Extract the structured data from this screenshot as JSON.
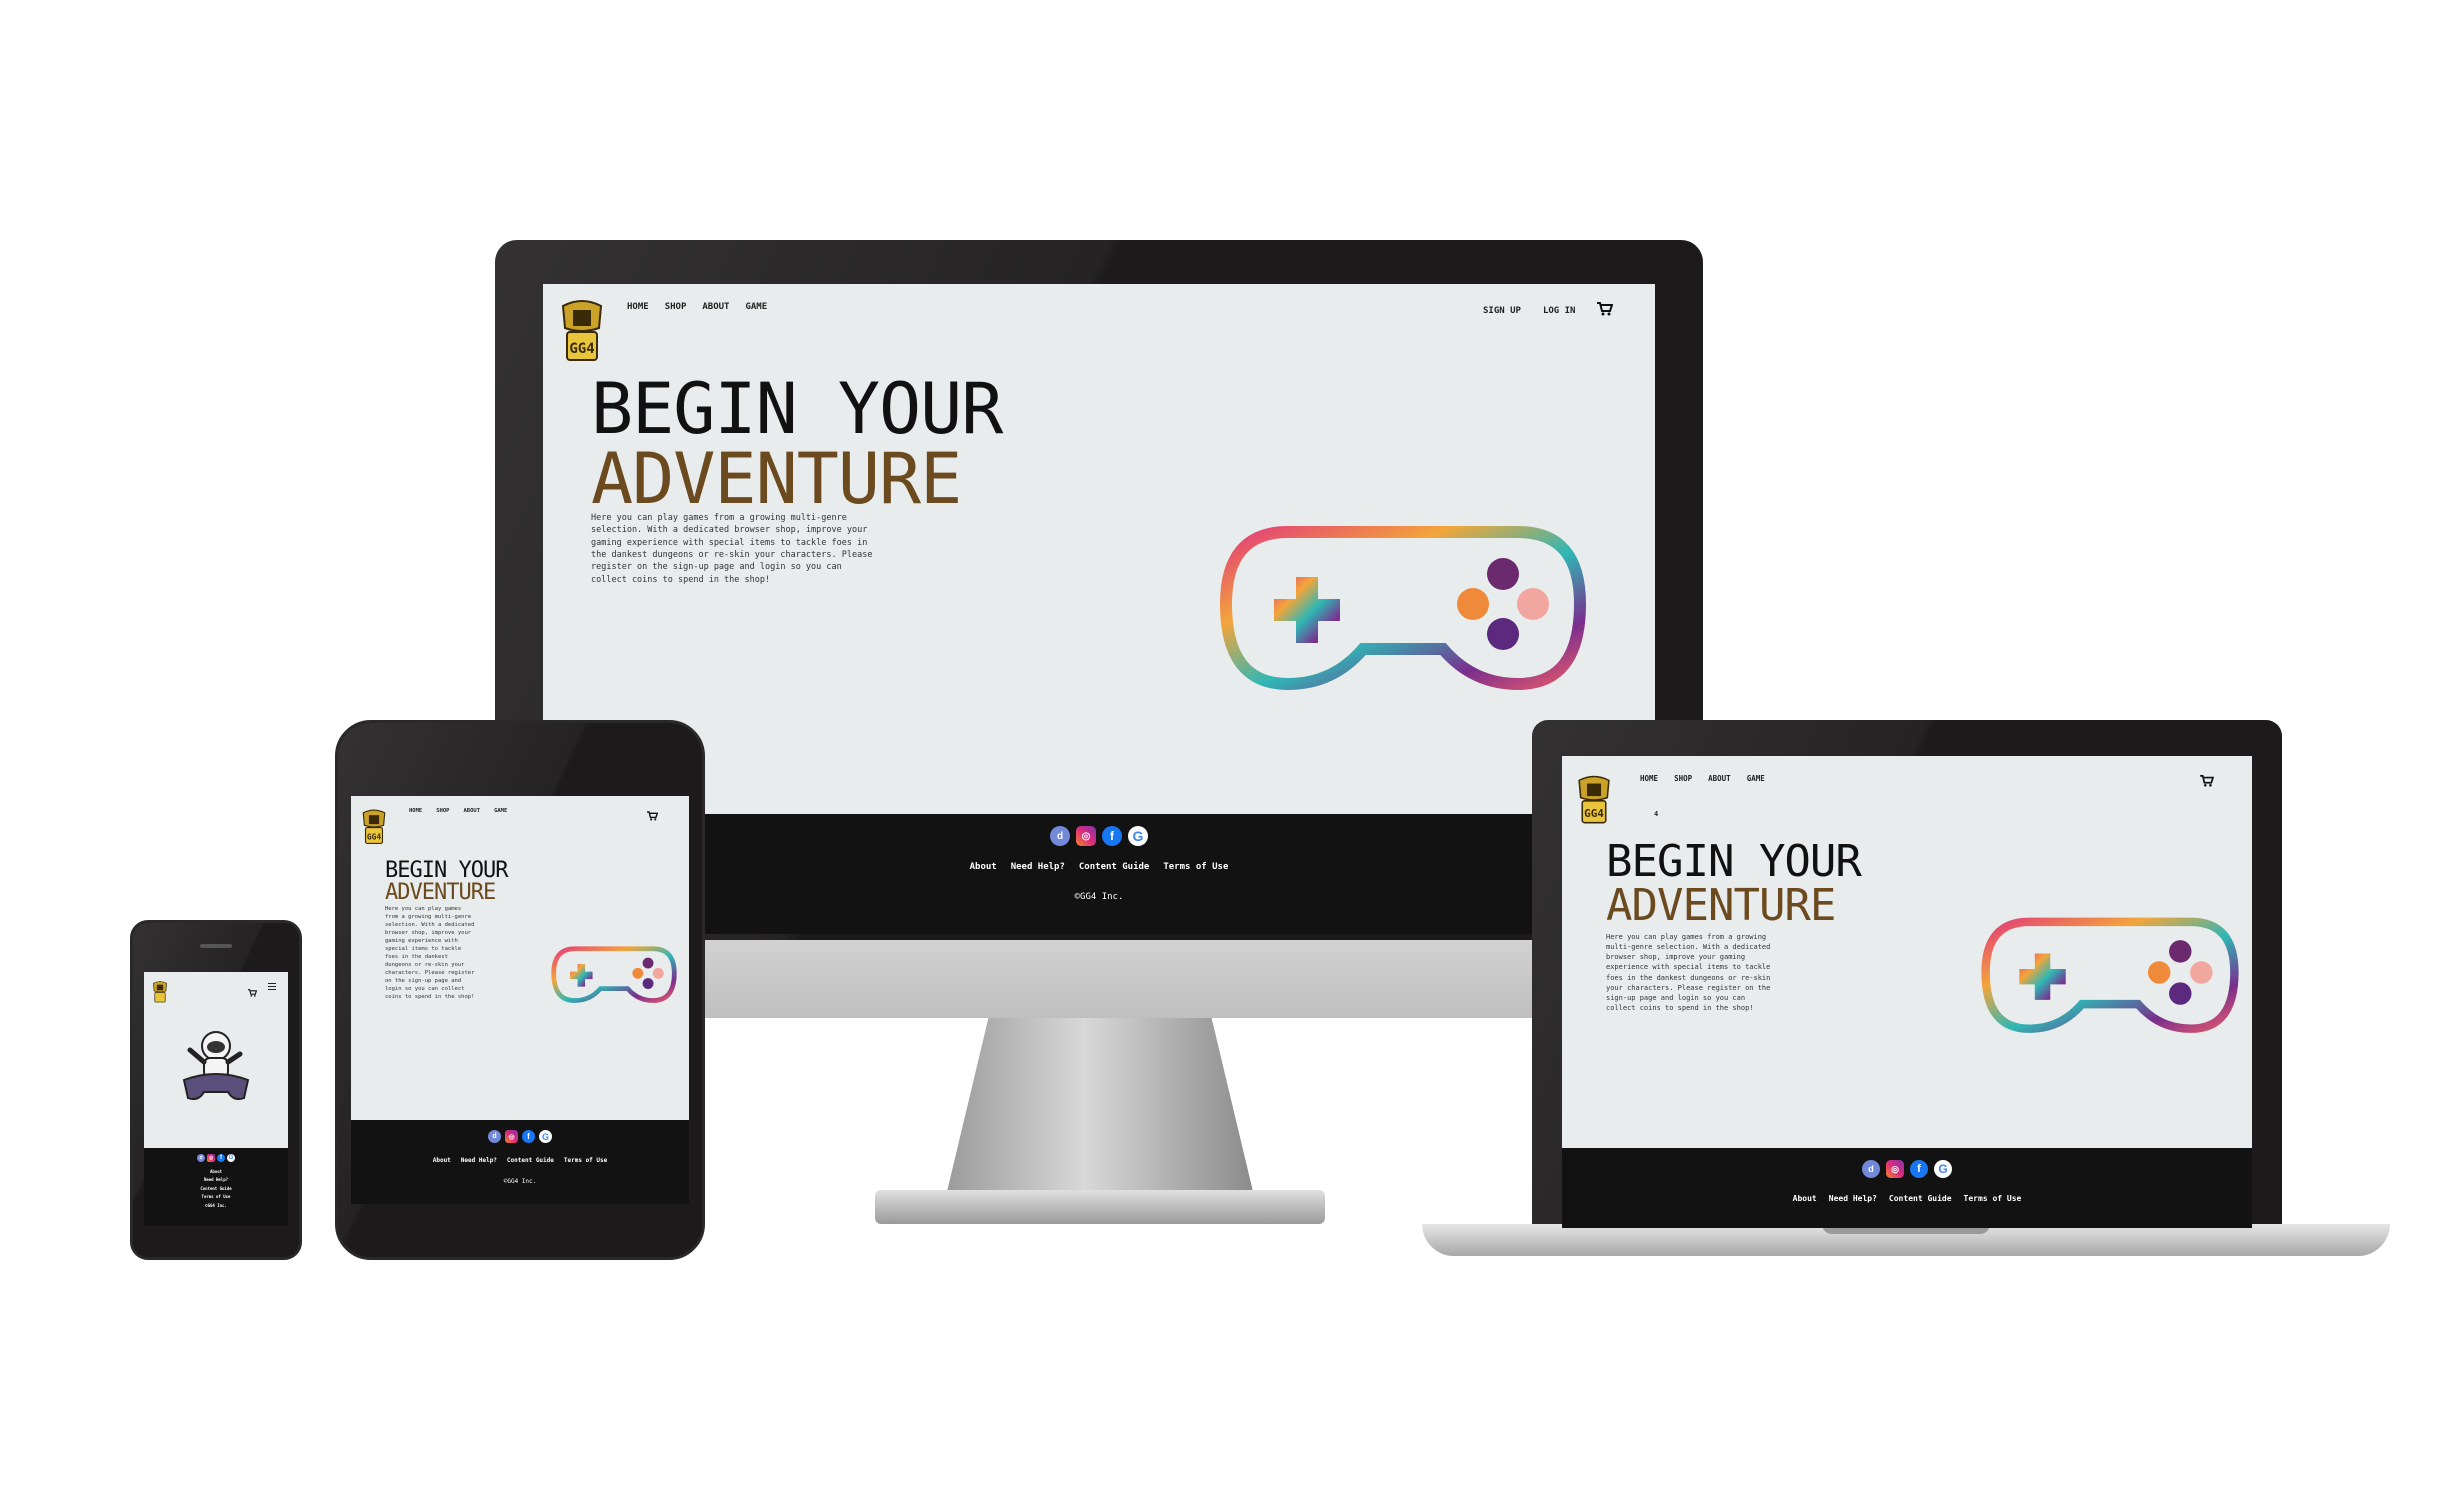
{
  "site": {
    "nav": {
      "home": "HOME",
      "shop": "SHOP",
      "about": "ABOUT",
      "game": "GAME",
      "signup": "SIGN UP",
      "login": "LOG IN"
    },
    "hero": {
      "line1": "BEGIN YOUR",
      "line2": "ADVENTURE",
      "description": "Here you can play games from a growing multi-genre selection. With a dedicated browser shop, improve your gaming experience with special items to tackle foes in the dankest dungeons or re-skin your characters. Please register on the sign-up page and login so you can collect coins to spend in the shop!"
    },
    "footer": {
      "links": [
        "About",
        "Need Help?",
        "Content Guide",
        "Terms of Use"
      ],
      "copyright": "©GG4 Inc."
    },
    "logo_text": "GG4",
    "laptop_badge": "4"
  },
  "icons": {
    "cart": "cart-icon",
    "menu": "hamburger-menu-icon",
    "social": [
      "discord-icon",
      "instagram-icon",
      "facebook-icon",
      "google-icon"
    ]
  },
  "colors": {
    "accent": "#6b4a1f",
    "footer_bg": "#121212",
    "screen_bg": "#e9ecec"
  }
}
